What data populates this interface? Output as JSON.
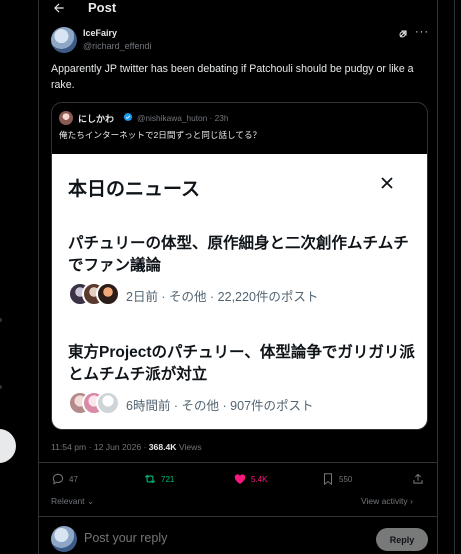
{
  "header": {
    "title": "Post"
  },
  "author": {
    "name": "IceFairy",
    "handle": "@richard_effendi"
  },
  "tweet": {
    "text": "Apparently JP twitter has been debating if Patchouli should be pudgy or like a rake."
  },
  "quote": {
    "name": "にしかわ",
    "meta": "@nishikawa_huton · 23h",
    "text": "俺たちインターネットで2日間ずっと同じ話してる？",
    "image": {
      "title": "本日のニュース",
      "items": [
        {
          "headline": "パチュリーの体型、原作細身と二次創作ムチムチでファン議論",
          "meta": "2日前 · その他 · 22,220件のポスト"
        },
        {
          "headline": "東方Projectのパチュリー、体型論争でガリガリ派とムチムチ派が対立",
          "meta": "6時間前 · その他 · 907件のポスト"
        }
      ]
    }
  },
  "stats": {
    "time": "11:54 pm · 12 Jun 2026 · ",
    "views": "368.4K",
    "views_label": " Views"
  },
  "actions": {
    "replies": "47",
    "reposts": "721",
    "likes": "5.4K",
    "bookmarks": "550"
  },
  "sort": {
    "label": "Relevant",
    "view_activity": "View activity"
  },
  "reply": {
    "placeholder": "Post your reply",
    "button": "Reply"
  },
  "colors": {
    "repost": "#00ba7c",
    "like": "#f91880",
    "muted": "#71767b",
    "accent": "#1d9bf0"
  }
}
